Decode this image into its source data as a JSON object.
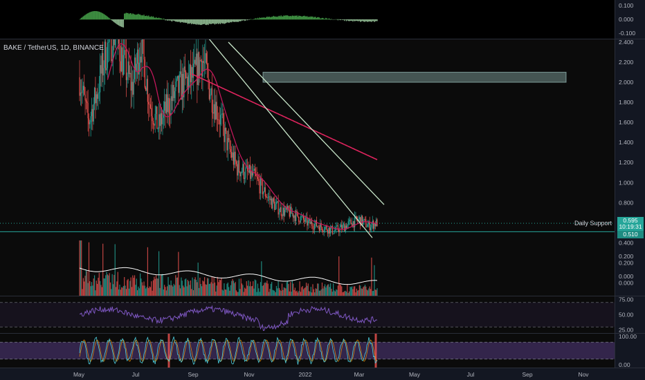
{
  "header": {
    "symbol": "BAKE / TetherUS, 1D, BINANCE"
  },
  "price_tag": {
    "value": "0.595",
    "time": "10:19:31",
    "support": "0.510"
  },
  "annotations": {
    "daily_support": "Daily Support"
  },
  "colors": {
    "background": "#131722",
    "up": "#26a69a",
    "down": "#ef5350",
    "ma_fast": "#c2185b",
    "ma_slow": "#e0245e",
    "trendline": "#c8e6c9",
    "rsi": "#7e57c2",
    "zone": "#b2dfdb",
    "support": "#26a69a"
  },
  "x_axis": {
    "labels": [
      "May",
      "Jul",
      "Sep",
      "Nov",
      "2022",
      "Mar",
      "May",
      "Jul",
      "Sep",
      "Nov"
    ]
  },
  "chart_data": [
    {
      "type": "bar",
      "panel": "histogram oscillator",
      "y_ticks": [
        "0.100",
        "0.000",
        "-0.100"
      ],
      "ylim": [
        -0.12,
        0.12
      ]
    },
    {
      "type": "line",
      "panel": "price",
      "y_ticks": [
        "2.400",
        "2.200",
        "2.000",
        "1.800",
        "1.600",
        "1.400",
        "1.200",
        "1.000",
        "0.800",
        "0.600",
        "0.400",
        "0.200",
        "0.000"
      ],
      "ylim": [
        -0.1,
        2.4
      ],
      "support_level": 0.51,
      "resistance_zone": [
        2.0,
        2.1
      ],
      "last_price": 0.595,
      "series": [
        {
          "values": [
            2.05,
            1.6,
            1.9,
            2.3,
            2.5,
            2.2,
            1.95,
            2.4,
            1.8,
            1.55,
            1.75,
            1.9,
            2.0,
            2.05,
            2.25,
            1.9,
            1.65,
            1.35,
            1.15,
            1.1,
            1.05,
            0.92,
            0.8,
            0.72,
            0.7,
            0.66,
            0.6,
            0.58,
            0.55,
            0.52,
            0.55,
            0.6,
            0.63,
            0.57,
            0.6
          ]
        }
      ]
    },
    {
      "type": "bar",
      "panel": "volume",
      "y_ticks": [
        "0.200",
        "0.000"
      ]
    },
    {
      "type": "line",
      "panel": "RSI",
      "y_ticks": [
        "75.00",
        "50.00",
        "25.00"
      ],
      "ylim": [
        20,
        80
      ]
    },
    {
      "type": "line",
      "panel": "stochastic",
      "y_ticks": [
        "100.00",
        "0.00"
      ],
      "ylim": [
        -10,
        110
      ]
    }
  ]
}
